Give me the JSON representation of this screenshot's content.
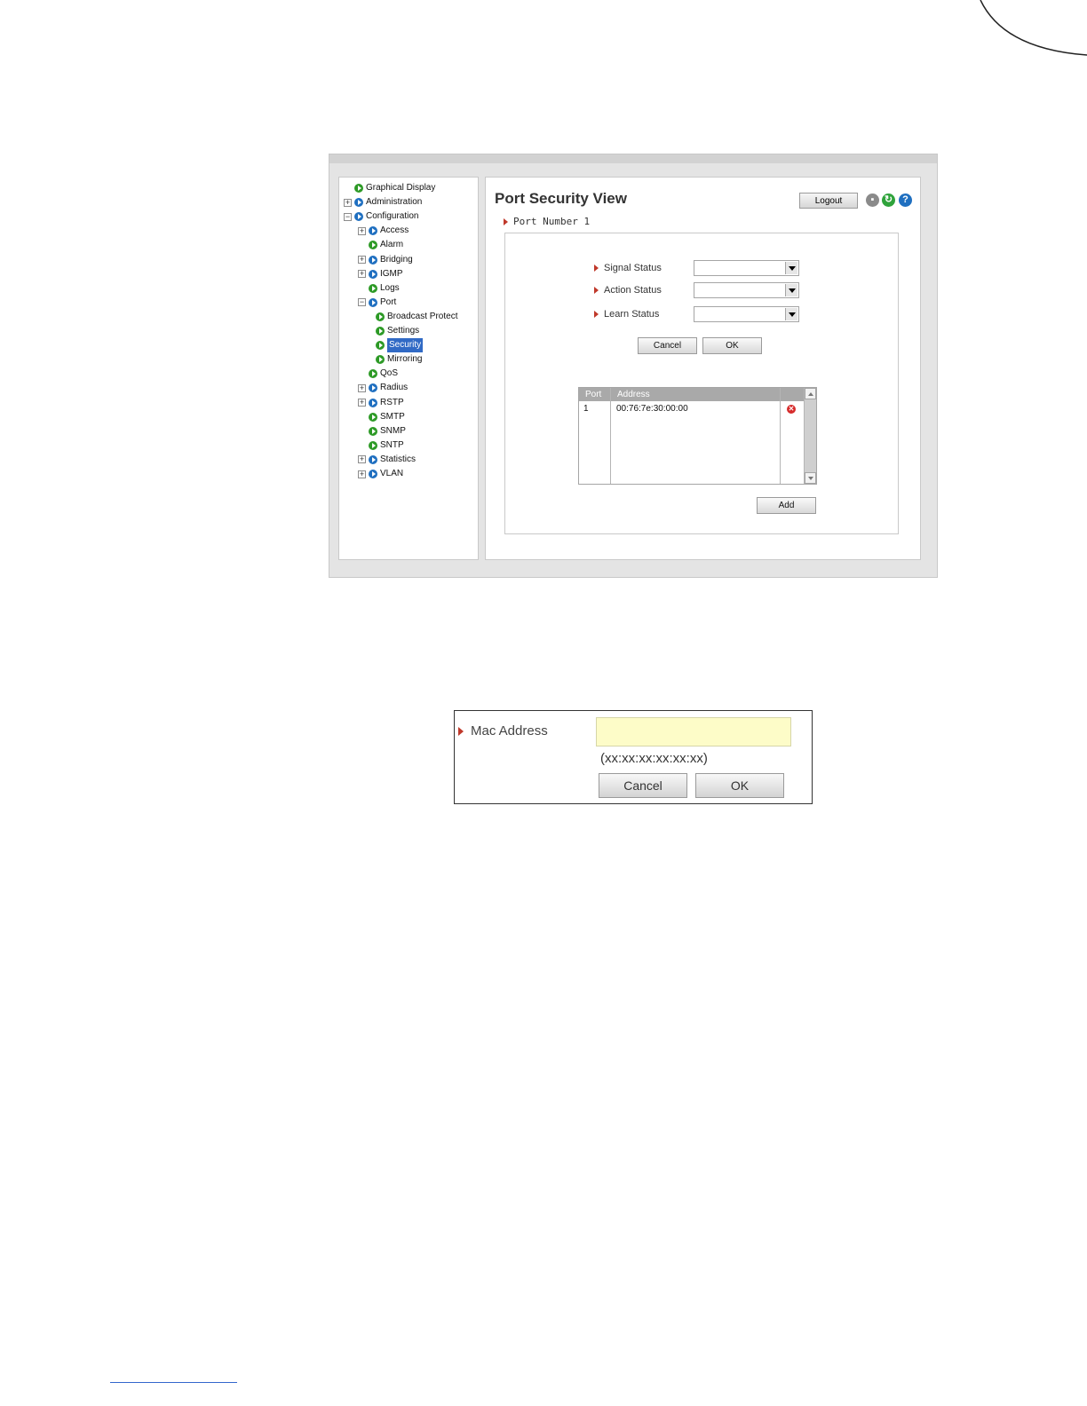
{
  "nav_tree": [
    {
      "label": "Graphical Display",
      "icon": "green",
      "expander": "",
      "indent": 0
    },
    {
      "label": "Administration",
      "icon": "blue",
      "expander": "+",
      "indent": 0
    },
    {
      "label": "Configuration",
      "icon": "blue",
      "expander": "−",
      "indent": 0
    },
    {
      "label": "Access",
      "icon": "blue",
      "expander": "+",
      "indent": 1
    },
    {
      "label": "Alarm",
      "icon": "green",
      "expander": "",
      "indent": 1
    },
    {
      "label": "Bridging",
      "icon": "blue",
      "expander": "+",
      "indent": 1
    },
    {
      "label": "IGMP",
      "icon": "blue",
      "expander": "+",
      "indent": 1
    },
    {
      "label": "Logs",
      "icon": "green",
      "expander": "",
      "indent": 1
    },
    {
      "label": "Port",
      "icon": "blue",
      "expander": "−",
      "indent": 1
    },
    {
      "label": "Broadcast Protect",
      "icon": "green",
      "expander": "",
      "indent": 2
    },
    {
      "label": "Settings",
      "icon": "green",
      "expander": "",
      "indent": 2
    },
    {
      "label": "Security",
      "icon": "green",
      "expander": "",
      "indent": 2,
      "selected": true
    },
    {
      "label": "Mirroring",
      "icon": "green",
      "expander": "",
      "indent": 2
    },
    {
      "label": "QoS",
      "icon": "green",
      "expander": "",
      "indent": 1
    },
    {
      "label": "Radius",
      "icon": "blue",
      "expander": "+",
      "indent": 1
    },
    {
      "label": "RSTP",
      "icon": "blue",
      "expander": "+",
      "indent": 1
    },
    {
      "label": "SMTP",
      "icon": "green",
      "expander": "",
      "indent": 1
    },
    {
      "label": "SNMP",
      "icon": "green",
      "expander": "",
      "indent": 1
    },
    {
      "label": "SNTP",
      "icon": "green",
      "expander": "",
      "indent": 1
    },
    {
      "label": "Statistics",
      "icon": "blue",
      "expander": "+",
      "indent": 1
    },
    {
      "label": "VLAN",
      "icon": "blue",
      "expander": "+",
      "indent": 1
    }
  ],
  "header": {
    "title": "Port Security View",
    "logout_label": "Logout",
    "icons": [
      "save-icon",
      "refresh-icon",
      "help-icon"
    ]
  },
  "port_section": {
    "port_number_label": "Port Number 1",
    "signal_status_label": "Signal Status",
    "signal_status_value": "",
    "action_status_label": "Action Status",
    "action_status_value": "",
    "learn_status_label": "Learn Status",
    "learn_status_value": "",
    "cancel_label": "Cancel",
    "ok_label": "OK"
  },
  "mac_table": {
    "headers": [
      "Port",
      "Address"
    ],
    "rows": [
      {
        "port": "1",
        "address": "00:76:7e:30:00:00"
      }
    ],
    "add_label": "Add"
  },
  "mac_dialog": {
    "label": "Mac Address",
    "value": "",
    "hint": "(xx:xx:xx:xx:xx:xx)",
    "cancel_label": "Cancel",
    "ok_label": "OK"
  },
  "colors": {
    "accent_arrow": "#c0392b",
    "selected_bg": "#316ac5",
    "input_highlight": "#fdfcc8"
  }
}
